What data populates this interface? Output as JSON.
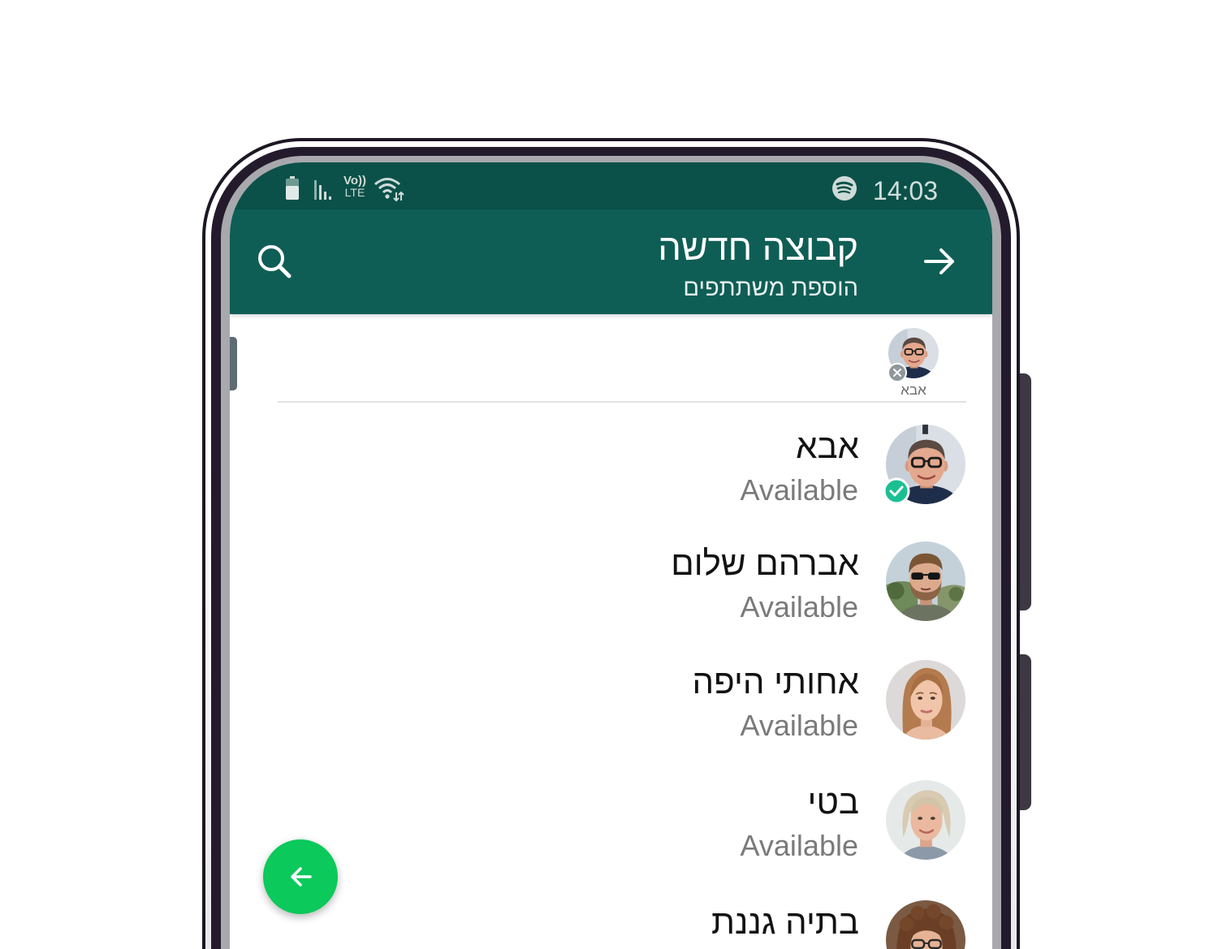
{
  "status_bar": {
    "time": "14:03",
    "volte_top": "Vo))",
    "volte_bottom": "LTE",
    "icons": [
      "battery-icon",
      "signal-icon",
      "volte-icon",
      "wifi-icon",
      "spotify-icon"
    ]
  },
  "app_bar": {
    "title": "קבוצה חדשה",
    "subtitle": "הוספת משתתפים",
    "back_icon": "arrow-right-icon",
    "search_icon": "search-icon"
  },
  "selected": [
    {
      "name": "אבא",
      "remove_icon": "close-icon"
    }
  ],
  "contacts": [
    {
      "name": "אבא",
      "status": "Available",
      "selected": true
    },
    {
      "name": "אברהם שלום",
      "status": "Available",
      "selected": false
    },
    {
      "name": "אחותי היפה",
      "status": "Available",
      "selected": false
    },
    {
      "name": "בטי",
      "status": "Available",
      "selected": false
    },
    {
      "name": "בתיה גננת",
      "selected": false
    }
  ],
  "fab": {
    "icon": "arrow-left-icon"
  },
  "colors": {
    "status_bar": "#0b5149",
    "app_bar": "#0f5e55",
    "fab": "#0bc95a",
    "check_badge": "#1cbf93"
  }
}
